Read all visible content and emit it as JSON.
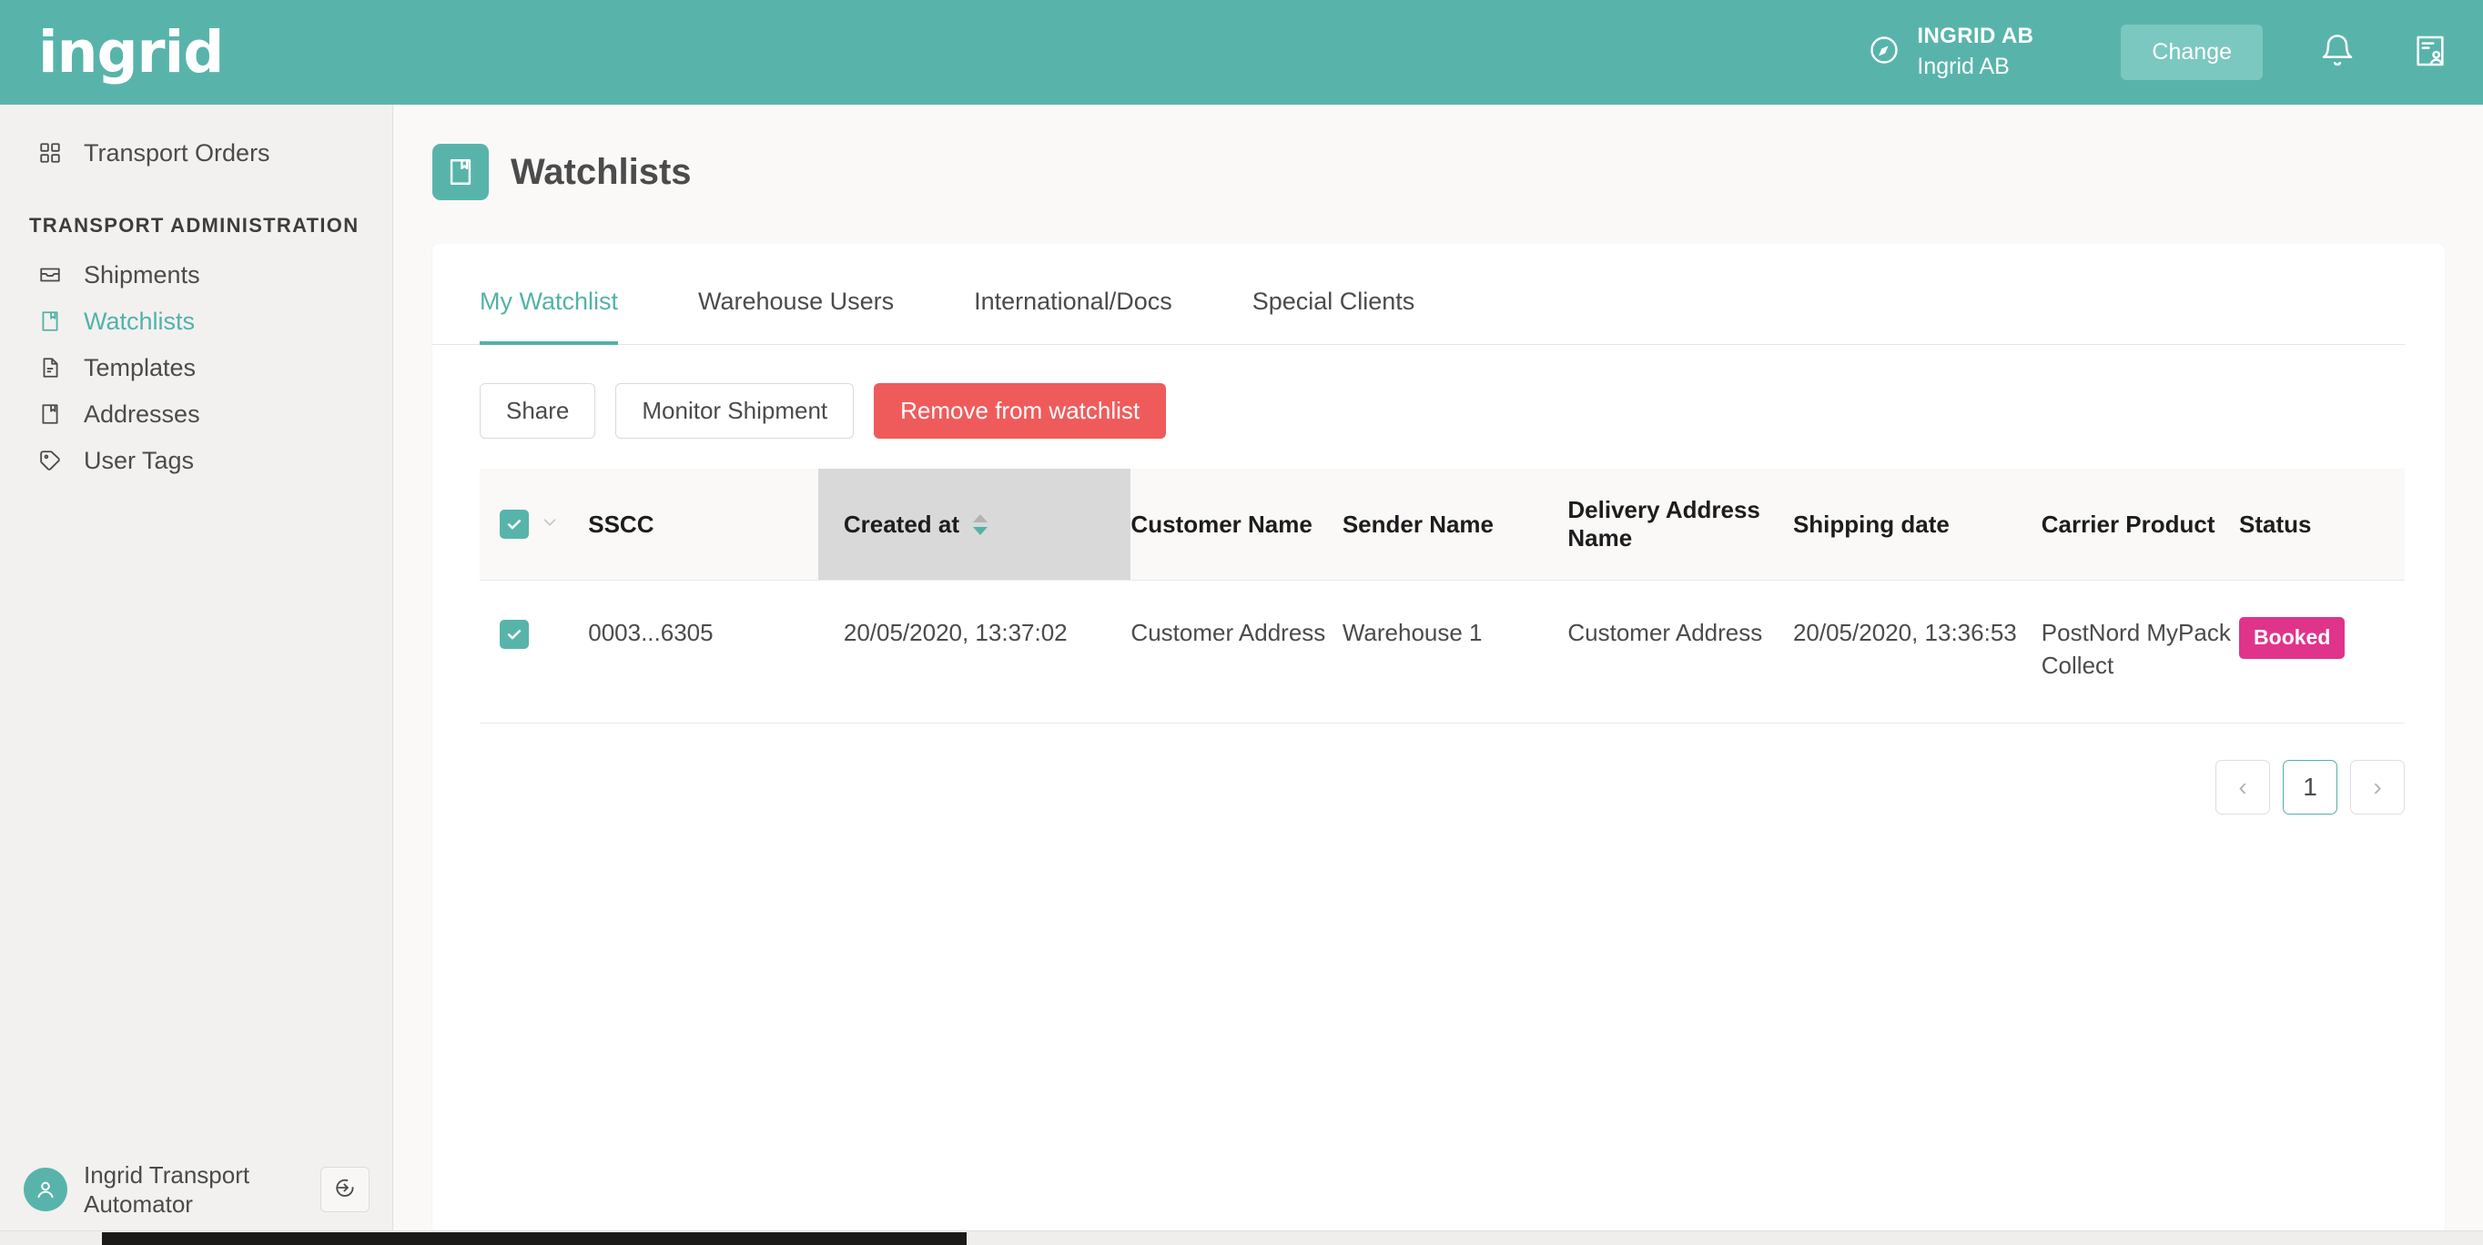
{
  "brand": {
    "logo_text": "ingrid",
    "accent": "#58b4ab",
    "danger": "#ef5b5b",
    "badge": "#e0348b"
  },
  "topbar": {
    "org_name": "INGRID AB",
    "org_sub": "Ingrid AB",
    "change_label": "Change",
    "compass_icon": "compass-icon",
    "bell_icon": "bell-icon",
    "contact_card_icon": "contact-card-icon"
  },
  "sidebar": {
    "top_items": [
      {
        "label": "Transport Orders",
        "icon": "grid-icon",
        "active": false
      }
    ],
    "section_label": "TRANSPORT ADMINISTRATION",
    "items": [
      {
        "label": "Shipments",
        "icon": "inbox-icon",
        "active": false
      },
      {
        "label": "Watchlists",
        "icon": "bookmark-doc-icon",
        "active": true
      },
      {
        "label": "Templates",
        "icon": "document-icon",
        "active": false
      },
      {
        "label": "Addresses",
        "icon": "bookmark-doc-icon",
        "active": false
      },
      {
        "label": "User Tags",
        "icon": "tag-icon",
        "active": false
      }
    ],
    "user": {
      "name": "Ingrid Transport Automator",
      "avatar_icon": "person-icon",
      "logout_icon": "logout-icon"
    }
  },
  "page": {
    "title": "Watchlists",
    "title_icon": "bookmark-doc-icon"
  },
  "tabs": [
    {
      "label": "My Watchlist",
      "active": true
    },
    {
      "label": "Warehouse Users",
      "active": false
    },
    {
      "label": "International/Docs",
      "active": false
    },
    {
      "label": "Special Clients",
      "active": false
    }
  ],
  "actions": [
    {
      "label": "Share",
      "style": "outline"
    },
    {
      "label": "Monitor Shipment",
      "style": "outline"
    },
    {
      "label": "Remove from watchlist",
      "style": "danger"
    }
  ],
  "table": {
    "select_all_checked": true,
    "columns": [
      {
        "key": "check",
        "label": ""
      },
      {
        "key": "sscc",
        "label": "SSCC"
      },
      {
        "key": "created",
        "label": "Created at",
        "sorted": true,
        "sort_dir": "desc"
      },
      {
        "key": "cust",
        "label": "Customer Name"
      },
      {
        "key": "sender",
        "label": "Sender Name"
      },
      {
        "key": "deliv",
        "label": "Delivery Address Name"
      },
      {
        "key": "ship",
        "label": "Shipping date"
      },
      {
        "key": "carrier",
        "label": "Carrier Product"
      },
      {
        "key": "status",
        "label": "Status"
      }
    ],
    "rows": [
      {
        "checked": true,
        "sscc": "0003...6305",
        "created": "20/05/2020, 13:37:02",
        "cust": "Customer Address",
        "sender": "Warehouse 1",
        "deliv": "Customer Address",
        "ship": "20/05/2020, 13:36:53",
        "carrier": "PostNord MyPack Collect",
        "status": "Booked"
      }
    ]
  },
  "pagination": {
    "prev_label": "‹",
    "pages": [
      "1"
    ],
    "current": "1",
    "next_label": "›"
  }
}
